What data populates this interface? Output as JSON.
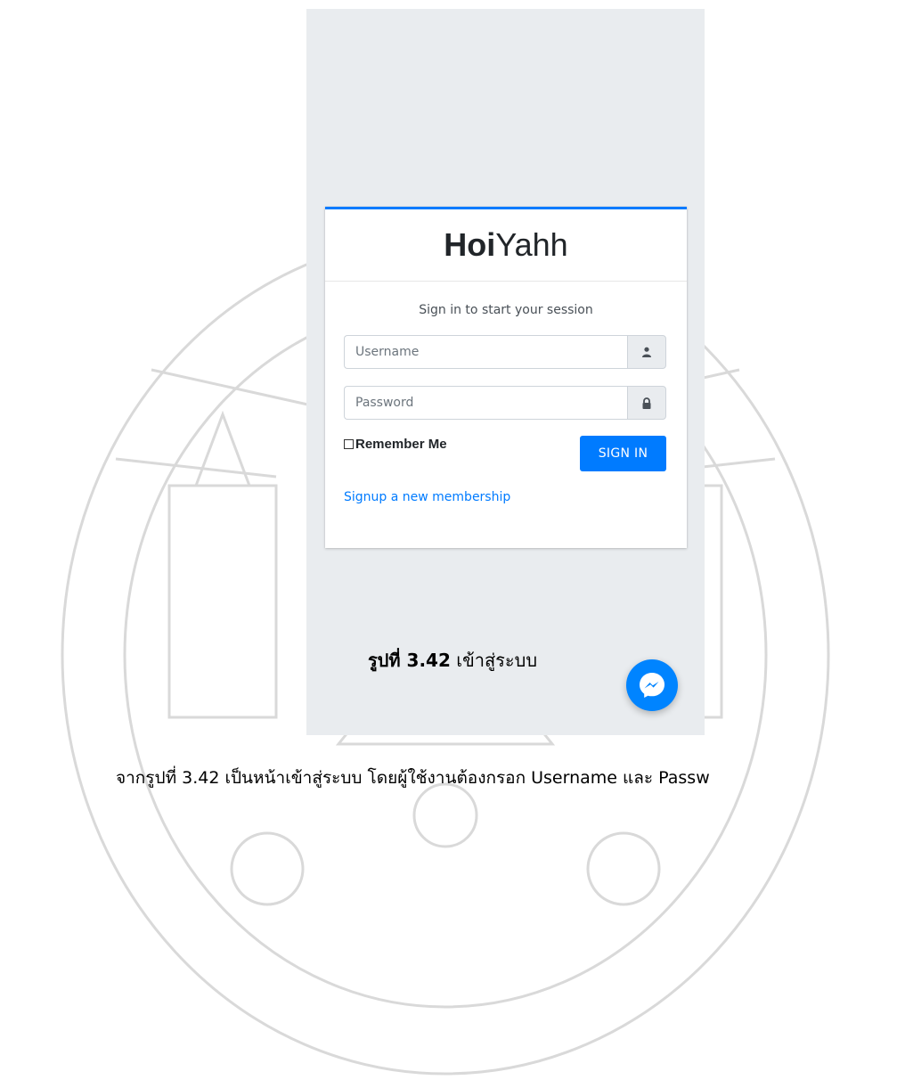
{
  "login": {
    "brand_bold": "Hoi",
    "brand_light": "Yahh",
    "subtitle": "Sign in to start your session",
    "username_placeholder": "Username",
    "password_placeholder": "Password",
    "remember_label": "Remember Me",
    "signin_label": "SIGN IN",
    "signup_link": "Signup a new membership"
  },
  "caption": {
    "label": "รูปที่ 3.42",
    "text": " เข้าสู่ระบบ"
  },
  "body_text": "จากรูปที่ 3.42 เป็นหน้าเข้าสู่ระบบ โดยผู้ใช้งานต้องกรอก Username และ Passw",
  "colors": {
    "primary": "#007bff",
    "page_background": "#e9ecef",
    "messenger": "#0084ff"
  },
  "icons": [
    "user-icon",
    "lock-icon",
    "messenger-icon"
  ]
}
